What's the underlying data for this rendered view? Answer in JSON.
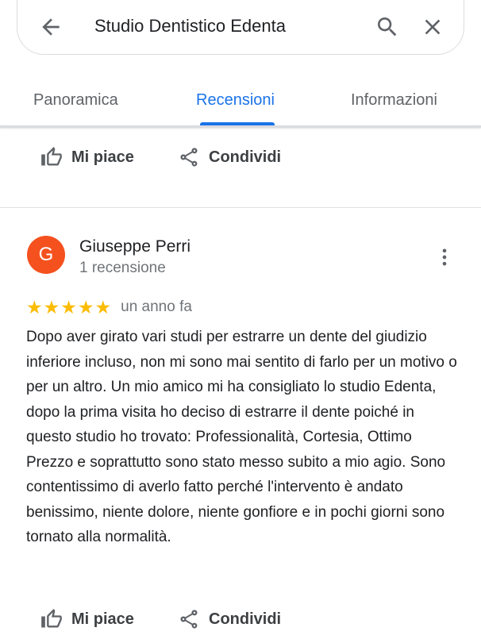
{
  "search": {
    "query": "Studio Dentistico Edenta"
  },
  "tabs": [
    {
      "label": "Panoramica"
    },
    {
      "label": "Recensioni"
    },
    {
      "label": "Informazioni"
    }
  ],
  "actions_top": {
    "like_label": "Mi piace",
    "share_label": "Condividi"
  },
  "review": {
    "avatar_initial": "G",
    "avatar_color": "#f4511e",
    "author": "Giuseppe Perri",
    "author_meta": "1 recensione",
    "rating": 5,
    "stars": "★★★★★",
    "date": "un anno fa",
    "text": "Dopo aver girato vari studi per estrarre un dente del giudizio inferiore incluso, non mi sono mai sentito di farlo per un motivo o per un altro. Un mio amico mi ha consigliato lo studio Edenta, dopo la prima visita ho deciso di estrarre il dente poiché in questo studio ho trovato: Professionalità, Cortesia, Ottimo Prezzo e soprattutto sono stato messo subito a mio agio. Sono contentissimo di averlo fatto perché l'intervento è andato benissimo, niente dolore, niente gonfiore e in pochi giorni sono tornato alla normalità.",
    "like_label": "Mi piace",
    "share_label": "Condividi"
  },
  "colors": {
    "accent": "#1a73e8",
    "star": "#fbbc04"
  }
}
